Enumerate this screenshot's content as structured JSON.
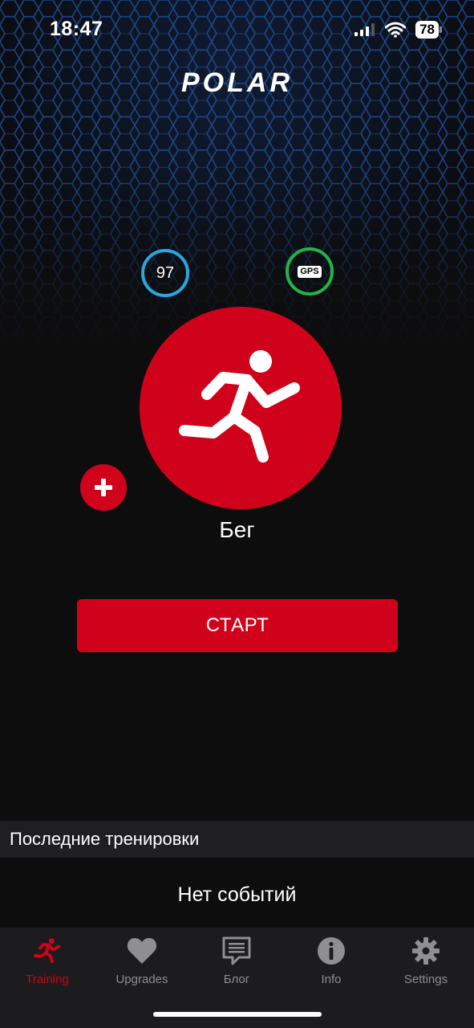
{
  "status_bar": {
    "time": "18:47",
    "battery": "78",
    "icons": [
      "signal-icon",
      "wifi-icon",
      "battery-icon"
    ]
  },
  "header": {
    "logo": "POLAR"
  },
  "indicators": {
    "heart_rate": "97",
    "gps_label": "GPS"
  },
  "sport": {
    "name": "Бег",
    "icon": "running-icon"
  },
  "actions": {
    "start_label": "СТАРТ",
    "add_icon": "plus-icon"
  },
  "recent": {
    "title": "Последние тренировки",
    "empty_text": "Нет событий"
  },
  "tabs": [
    {
      "label": "Training",
      "icon": "running-icon",
      "active": true
    },
    {
      "label": "Upgrades",
      "icon": "heart-icon",
      "active": false
    },
    {
      "label": "Блог",
      "icon": "chat-icon",
      "active": false
    },
    {
      "label": "Info",
      "icon": "info-icon",
      "active": false
    },
    {
      "label": "Settings",
      "icon": "gear-icon",
      "active": false
    }
  ],
  "colors": {
    "accent_red": "#d0021b",
    "hr_ring": "#2aa6e0",
    "gps_ring": "#23b34a",
    "background": "#0d0d0e",
    "tab_inactive": "#8e8e93"
  }
}
